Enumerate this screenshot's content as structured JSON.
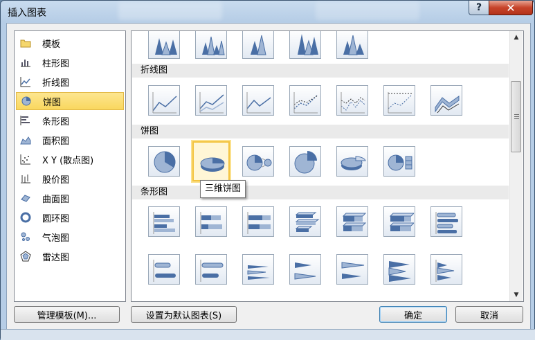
{
  "window": {
    "title": "插入图表",
    "help_label": "?",
    "close_label": "✕"
  },
  "left_list": {
    "items": [
      {
        "label": "模板",
        "icon": "folder-icon",
        "selected": false
      },
      {
        "label": "柱形图",
        "icon": "column-chart-icon",
        "selected": false
      },
      {
        "label": "折线图",
        "icon": "line-chart-icon",
        "selected": false
      },
      {
        "label": "饼图",
        "icon": "pie-chart-icon",
        "selected": true
      },
      {
        "label": "条形图",
        "icon": "bar-chart-icon",
        "selected": false
      },
      {
        "label": "面积图",
        "icon": "area-chart-icon",
        "selected": false
      },
      {
        "label": "X Y (散点图)",
        "icon": "scatter-chart-icon",
        "selected": false
      },
      {
        "label": "股价图",
        "icon": "stock-chart-icon",
        "selected": false
      },
      {
        "label": "曲面图",
        "icon": "surface-chart-icon",
        "selected": false
      },
      {
        "label": "圆环图",
        "icon": "doughnut-chart-icon",
        "selected": false
      },
      {
        "label": "气泡图",
        "icon": "bubble-chart-icon",
        "selected": false
      },
      {
        "label": "雷达图",
        "icon": "radar-chart-icon",
        "selected": false
      }
    ]
  },
  "gallery": {
    "sections": [
      {
        "header": "折线图"
      },
      {
        "header": "饼图"
      },
      {
        "header": "条形图"
      }
    ],
    "tooltip": "三维饼图"
  },
  "footer": {
    "manage_templates": "管理模板(M)...",
    "set_default": "设置为默认图表(S)",
    "ok": "确定",
    "cancel": "取消"
  },
  "colors": {
    "selection": "#f9d75e",
    "accent": "#4a6fa5"
  }
}
